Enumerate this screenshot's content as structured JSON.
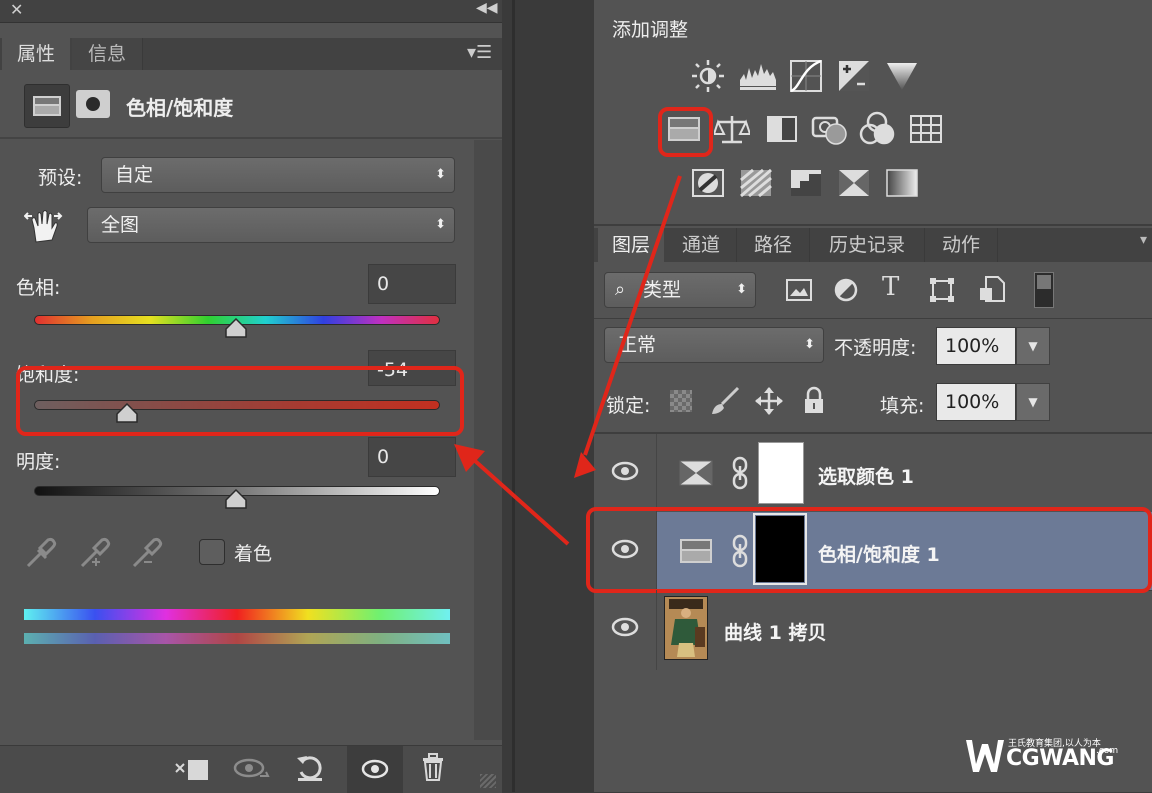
{
  "properties_panel": {
    "tabs": [
      {
        "label": "属性",
        "active": true
      },
      {
        "label": "信息",
        "active": false
      }
    ],
    "adjustment_title": "色相/饱和度",
    "preset_label": "预设:",
    "preset_value": "自定",
    "range_value": "全图",
    "hue": {
      "label": "色相:",
      "value": "0",
      "fraction": 0.5
    },
    "saturation": {
      "label": "饱和度:",
      "value": "-54",
      "fraction": 0.23
    },
    "lightness": {
      "label": "明度:",
      "value": "0",
      "fraction": 0.5
    },
    "colorize_label": "着色",
    "colorize_checked": false
  },
  "adjustments_panel": {
    "title": "添加调整"
  },
  "layers_panel": {
    "tabs": [
      {
        "label": "图层",
        "active": true
      },
      {
        "label": "通道",
        "active": false
      },
      {
        "label": "路径",
        "active": false
      },
      {
        "label": "历史记录",
        "active": false
      },
      {
        "label": "动作",
        "active": false
      }
    ],
    "filter_type": "类型",
    "blend_mode": "正常",
    "opacity_label": "不透明度:",
    "opacity_value": "100%",
    "lock_label": "锁定:",
    "fill_label": "填充:",
    "fill_value": "100%",
    "layers": [
      {
        "name": "选取颜色 1",
        "selected": false,
        "mask": "white"
      },
      {
        "name": "色相/饱和度 1",
        "selected": true,
        "mask": "black"
      },
      {
        "name": "曲线 1 拷贝",
        "selected": false,
        "mask": "photo"
      }
    ]
  },
  "watermark": {
    "tagline": "王氏教育集团,以人为本",
    "brand": "CGWANG",
    "domain": ".com"
  },
  "colors": {
    "highlight_red": "#e0261a",
    "selected_layer": "#6c7a96",
    "panel_bg": "#535353"
  }
}
